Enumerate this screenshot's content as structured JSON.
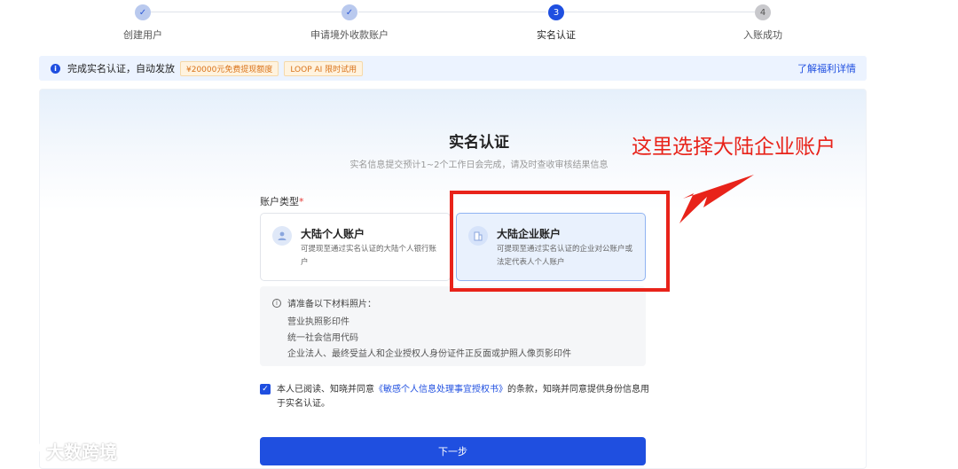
{
  "steps": [
    {
      "label": "创建用户",
      "marker": "✓",
      "state": "done"
    },
    {
      "label": "申请境外收款账户",
      "marker": "✓",
      "state": "done"
    },
    {
      "label": "实名认证",
      "marker": "3",
      "state": "active"
    },
    {
      "label": "入账成功",
      "marker": "4",
      "state": "todo"
    }
  ],
  "notice": {
    "text": "完成实名认证，自动发放",
    "tags": [
      "¥20000元免费提现额度",
      "LOOP AI 限时试用"
    ],
    "link": "了解福利详情"
  },
  "form": {
    "title": "实名认证",
    "subtitle": "实名信息提交预计1~2个工作日会完成，请及时查收审核结果信息",
    "account_type_label": "账户类型",
    "required_mark": "*",
    "options": [
      {
        "title": "大陆个人账户",
        "desc": "可提现至通过实名认证的大陆个人银行账户",
        "selected": false,
        "icon": "user-icon"
      },
      {
        "title": "大陆企业账户",
        "desc": "可提现至通过实名认证的企业对公账户或法定代表人个人账户",
        "selected": true,
        "icon": "building-icon"
      }
    ],
    "prep": {
      "heading": "请准备以下材料照片：",
      "items": [
        "营业执照影印件",
        "统一社会信用代码",
        "企业法人、最终受益人和企业授权人身份证件正反面或护照人像页影印件"
      ]
    },
    "agreement": {
      "prefix": "本人已阅读、知晓并同意",
      "link": "《敏感个人信息处理事宜授权书》",
      "suffix": "的条款，知晓并同意提供身份信息用于实名认证。",
      "checked": true
    },
    "next_button": "下一步"
  },
  "annotation": {
    "text": "这里选择大陆企业账户",
    "color": "#e8231a"
  },
  "watermark": "大数跨境",
  "colors": {
    "primary": "#1f4fe0",
    "annotation": "#e8231a"
  }
}
